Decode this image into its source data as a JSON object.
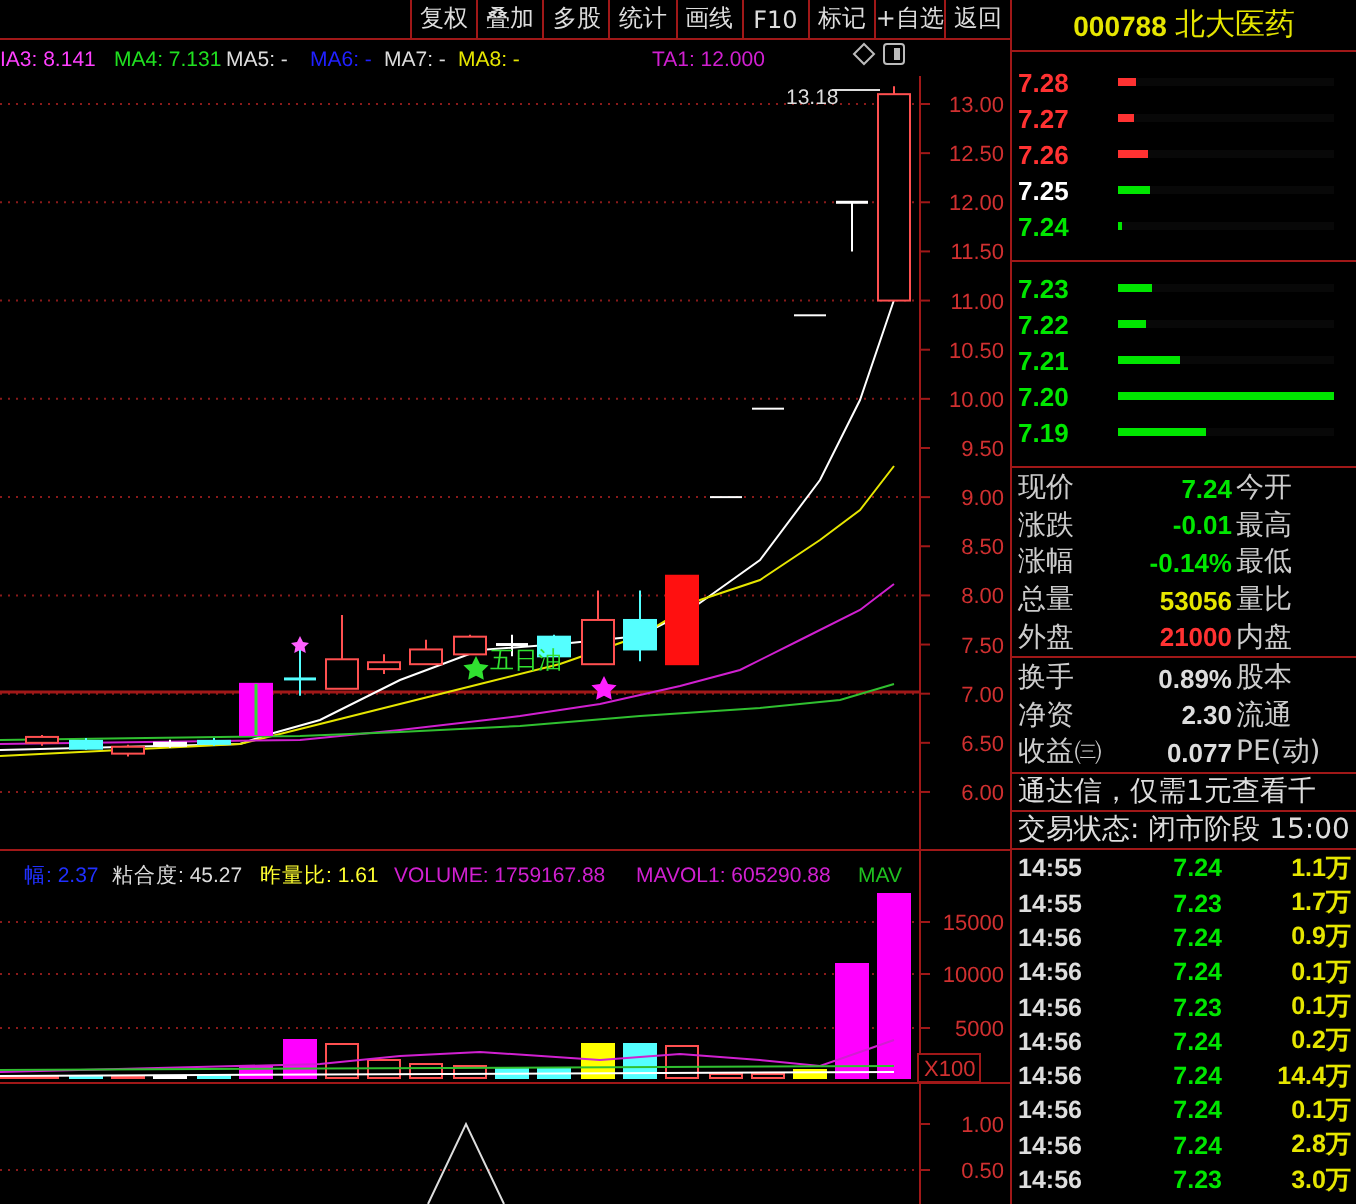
{
  "toolbar": [
    {
      "label": "复权"
    },
    {
      "label": "叠加"
    },
    {
      "label": "多股"
    },
    {
      "label": "统计"
    },
    {
      "label": "画线"
    },
    {
      "label": "F10"
    },
    {
      "label": "标记"
    },
    {
      "label": "+自选"
    },
    {
      "label": "返回"
    }
  ],
  "ma_legend": [
    {
      "text": "IA3: 8.141",
      "color": "#ff40ff"
    },
    {
      "text": "MA4: 7.131",
      "color": "#20e020"
    },
    {
      "text": "MA5: -",
      "color": "#dddddd"
    },
    {
      "text": "MA6: -",
      "color": "#2020ff"
    },
    {
      "text": "MA7: -",
      "color": "#dddddd"
    },
    {
      "text": "MA8: -",
      "color": "#e6e600"
    },
    {
      "text": "TA1: 12.000",
      "color": "#d020d0"
    }
  ],
  "price_chart": {
    "high_label": "13.18",
    "signal_label": "五日油",
    "axis": [
      "13.00",
      "12.50",
      "12.00",
      "11.50",
      "11.00",
      "10.50",
      "10.00",
      "9.50",
      "9.00",
      "8.50",
      "8.00",
      "7.50",
      "7.00",
      "6.50",
      "6.00"
    ]
  },
  "volume_legend": [
    {
      "text": "幅: 2.37",
      "color": "#2030ff"
    },
    {
      "text": "粘合度: 45.27",
      "color": "#dddddd"
    },
    {
      "text": "昨量比: 1.61",
      "color": "#ffff30"
    },
    {
      "text": "VOLUME: 1759167.88",
      "color": "#d020d0"
    },
    {
      "text": "MAVOL1: 605290.88",
      "color": "#d020d0"
    },
    {
      "text": "MAV",
      "color": "#20c020"
    }
  ],
  "volume_chart": {
    "axis": [
      "15000",
      "10000",
      "5000"
    ],
    "unit": "X100"
  },
  "indicator_chart": {
    "axis": [
      "1.00",
      "0.50"
    ]
  },
  "quote": {
    "code": "000788",
    "name": "北大医药"
  },
  "asks": [
    {
      "price": "7.28",
      "color": "#ff3232",
      "kind": "up",
      "level": 0.08
    },
    {
      "price": "7.27",
      "color": "#ff3232",
      "kind": "up",
      "level": 0.07
    },
    {
      "price": "7.26",
      "color": "#ff3232",
      "kind": "up",
      "level": 0.14
    },
    {
      "price": "7.25",
      "color": "#ffffff",
      "kind": "down",
      "level": 0.15
    },
    {
      "price": "7.24",
      "color": "#00e600",
      "kind": "down",
      "level": 0.02
    }
  ],
  "bids": [
    {
      "price": "7.23",
      "color": "#00e600",
      "kind": "down",
      "level": 0.16
    },
    {
      "price": "7.22",
      "color": "#00e600",
      "kind": "down",
      "level": 0.13
    },
    {
      "price": "7.21",
      "color": "#00e600",
      "kind": "down",
      "level": 0.29
    },
    {
      "price": "7.20",
      "color": "#00e600",
      "kind": "down",
      "level": 1.0
    },
    {
      "price": "7.19",
      "color": "#00e600",
      "kind": "down",
      "level": 0.41
    }
  ],
  "stats": [
    {
      "label": "现价",
      "value": "7.24",
      "color": "#00e600",
      "label2": "今开"
    },
    {
      "label": "涨跌",
      "value": "-0.01",
      "color": "#00e600",
      "label2": "最高"
    },
    {
      "label": "涨幅",
      "value": "-0.14%",
      "color": "#00e600",
      "label2": "最低"
    },
    {
      "label": "总量",
      "value": "53056",
      "color": "#e6e600",
      "label2": "量比"
    },
    {
      "label": "外盘",
      "value": "21000",
      "color": "#ff3232",
      "label2": "内盘"
    }
  ],
  "finance": [
    {
      "label": "换手",
      "value": "0.89%",
      "label2": "股本"
    },
    {
      "label": "净资",
      "value": "2.30",
      "label2": "流通"
    },
    {
      "label": "收益㈢",
      "value": "0.077",
      "label2": "PE(动)"
    }
  ],
  "ad_text": "通达信，仅需1元查看千",
  "status": "交易状态: 闭市阶段 15:00",
  "ticks": [
    {
      "time": "14:55",
      "price": "7.24",
      "volume": "1.1万"
    },
    {
      "time": "14:55",
      "price": "7.23",
      "volume": "1.7万"
    },
    {
      "time": "14:56",
      "price": "7.24",
      "volume": "0.9万"
    },
    {
      "time": "14:56",
      "price": "7.24",
      "volume": "0.1万"
    },
    {
      "time": "14:56",
      "price": "7.23",
      "volume": "0.1万"
    },
    {
      "time": "14:56",
      "price": "7.24",
      "volume": "0.2万"
    },
    {
      "time": "14:56",
      "price": "7.24",
      "volume": "14.4万"
    },
    {
      "time": "14:56",
      "price": "7.24",
      "volume": "0.1万"
    },
    {
      "time": "14:56",
      "price": "7.24",
      "volume": "2.8万"
    },
    {
      "time": "14:56",
      "price": "7.23",
      "volume": "3.0万"
    }
  ]
}
